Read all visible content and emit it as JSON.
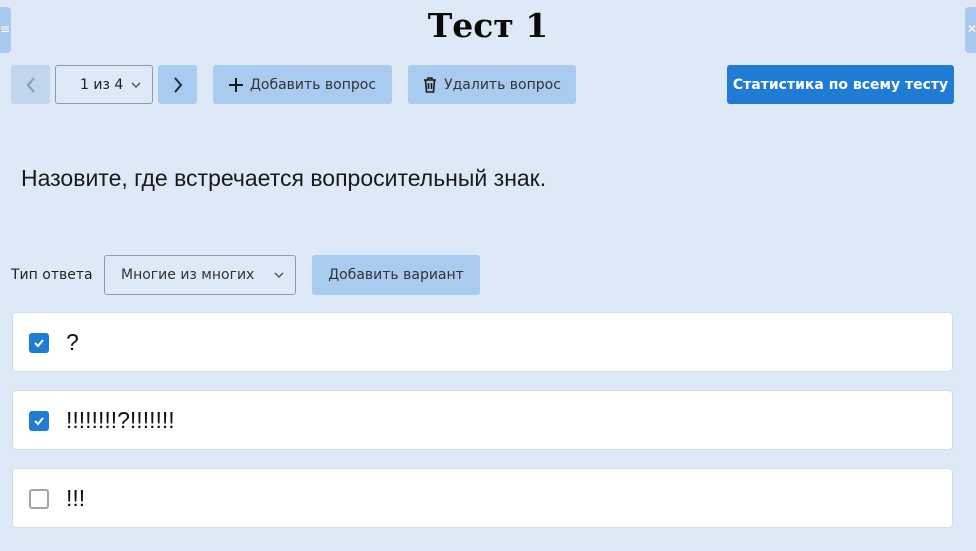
{
  "header": {
    "title": "Тест 1"
  },
  "edges": {
    "left_icon": "menu-icon",
    "right_icon": "close-icon",
    "left_glyph": "≡",
    "right_glyph": "✕"
  },
  "toolbar": {
    "pager_value": "1 из 4",
    "add_question_label": "Добавить вопрос",
    "delete_question_label": "Удалить вопрос",
    "stats_label": "Статистика по всему тесту"
  },
  "question": {
    "text": "Назовите, где встречается вопросительный знак."
  },
  "answer_type": {
    "label": "Тип ответа",
    "selected": "Многие из многих",
    "add_variant_label": "Добавить вариант"
  },
  "options": [
    {
      "text": "?",
      "checked": true
    },
    {
      "text": "!!!!!!!!?!!!!!!!",
      "checked": true
    },
    {
      "text": "!!!",
      "checked": false
    }
  ],
  "colors": {
    "background": "#dde9f7",
    "accent": "#1f7bd3",
    "light_button": "#a9cbef"
  }
}
